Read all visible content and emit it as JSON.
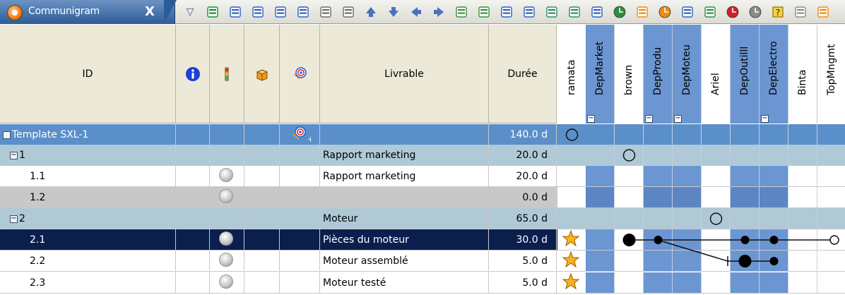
{
  "tab": {
    "title": "Communigram",
    "close_label": "X"
  },
  "toolbar": {
    "buttons": [
      "sum-icon",
      "delete-icon",
      "print-preview-icon",
      "print-icon",
      "copy-icon",
      "cut-icon",
      "paste-icon",
      "arrow-up-icon",
      "arrow-down-icon",
      "arrow-left-icon",
      "arrow-right-icon",
      "expand-all-icon",
      "collapse-all-icon",
      "calendar-icon",
      "calendar-grid-icon",
      "link-task-icon",
      "diagonal-arrow-icon",
      "report-icon",
      "clock-icon",
      "package-icon",
      "target-icon",
      "export-icon",
      "users-icon",
      "pie-chart-icon",
      "gray-circle-icon",
      "help-icon",
      "list-icon",
      "more-icon"
    ]
  },
  "columns": {
    "id": "ID",
    "livrable": "Livrable",
    "duree": "Durée",
    "info_icon": "info-icon",
    "status_icon": "traffic-light-icon",
    "package_icon": "package-icon",
    "target_icon": "target-icon"
  },
  "matrix_columns": [
    {
      "label": "ramata",
      "style": "white",
      "collapsible": false
    },
    {
      "label": "DepMarket",
      "style": "blue",
      "collapsible": true
    },
    {
      "label": "brown",
      "style": "white",
      "collapsible": false
    },
    {
      "label": "DepProdu",
      "style": "blue",
      "collapsible": true
    },
    {
      "label": "DepMoteu",
      "style": "blue",
      "collapsible": true
    },
    {
      "label": "Ariel",
      "style": "white",
      "collapsible": false
    },
    {
      "label": "DepOutilll",
      "style": "blue",
      "collapsible": false
    },
    {
      "label": "DepElectro",
      "style": "blue",
      "collapsible": true
    },
    {
      "label": "Binta",
      "style": "white",
      "collapsible": false
    },
    {
      "label": "TopMngmt",
      "style": "white",
      "collapsible": false
    }
  ],
  "rows": [
    {
      "id": "Template SXL-1",
      "livrable": "",
      "duree": "140.0 d",
      "kind": "root",
      "has_minus": true,
      "target": true
    },
    {
      "id": "1",
      "livrable": "Rapport marketing",
      "duree": "20.0 d",
      "kind": "group",
      "has_minus": true
    },
    {
      "id": "1.1",
      "livrable": "Rapport marketing",
      "duree": "20.0 d",
      "kind": "task",
      "ball": true
    },
    {
      "id": "1.2",
      "livrable": "",
      "duree": "0.0 d",
      "kind": "gray",
      "ball": true
    },
    {
      "id": "2",
      "livrable": "Moteur",
      "duree": "65.0 d",
      "kind": "group",
      "has_minus": true
    },
    {
      "id": "2.1",
      "livrable": "Pièces du moteur",
      "duree": "30.0 d",
      "kind": "selected",
      "ball": true,
      "star": true
    },
    {
      "id": "2.2",
      "livrable": "Moteur assemblé",
      "duree": "5.0 d",
      "kind": "task",
      "ball": true,
      "star": true
    },
    {
      "id": "2.3",
      "livrable": "Moteur testé",
      "duree": "5.0 d",
      "kind": "task",
      "ball": true,
      "star": true
    }
  ],
  "colors": {
    "root_row": "#5b8fca",
    "group_row": "#afc9d6",
    "selected_row": "#0b1f4e",
    "gray_row": "#c8c8c8",
    "matrix_blue": "#6b96d2",
    "header_beige": "#ece9d8"
  }
}
